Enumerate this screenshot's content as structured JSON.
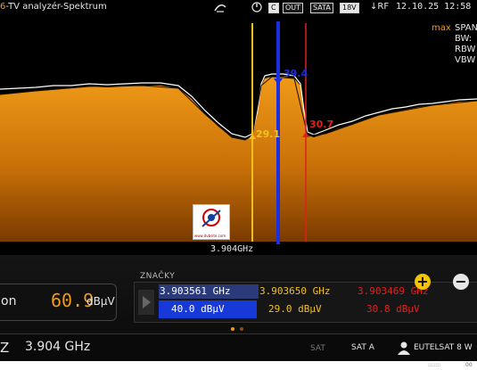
{
  "statusbar": {
    "title_num": "6",
    "title": "-TV analyzér-Spektrum",
    "badge_c": "C",
    "badge_out": "OUT",
    "badge_sat": "SATA",
    "badge_volt": "18V",
    "rf": "↓RF",
    "datetime": "12.10.25 12:58",
    "icons": [
      "satellite-dish-icon",
      "power-icon"
    ]
  },
  "spectrum": {
    "info": {
      "max": "max",
      "lines": [
        "SPAN",
        "BW:",
        "RBW",
        "VBW"
      ]
    },
    "marker_labels": {
      "m1": "39.4",
      "m2": "29.1",
      "m3": "30.7"
    },
    "center_freq": "3.904GHz",
    "colors": {
      "fill": "#e88a10",
      "trace": "#ffffff",
      "m1": "#1c2fe0",
      "m2": "#f0c020",
      "m3": "#e02020"
    },
    "logo_caption": "www.dvbsite.com"
  },
  "level": {
    "label": "on",
    "value": "60.9",
    "unit": "dBμV"
  },
  "markers": {
    "title": "ZNAČKY",
    "items": [
      {
        "freq": "3.903561 GHz",
        "value": "40.0 dBμV",
        "color": "#ffffff"
      },
      {
        "freq": "3.903650 GHz",
        "value": "29.0 dBμV",
        "color": "#f0c020"
      },
      {
        "freq": "3.903469 GHz",
        "value": "30.8 dBμV",
        "color": "#e02020"
      }
    ],
    "plus": "+",
    "minus": "−"
  },
  "bottombar": {
    "freq_prefix": "Z",
    "freq": "3.904 GHz",
    "sat_logo": "SAT",
    "sat": "SAT A",
    "sat_name": "EUTELSAT 8 W"
  },
  "taskbar": {
    "t1": ":::::::",
    "t2": "00"
  }
}
